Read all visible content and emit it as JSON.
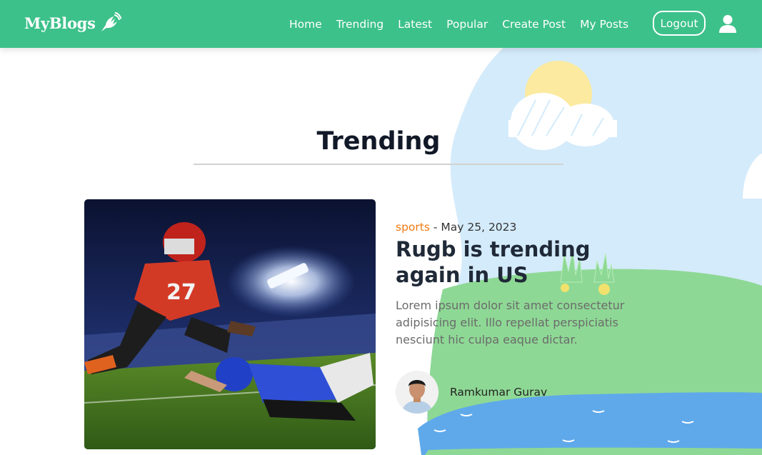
{
  "navbar": {
    "brand": "MyBlogs",
    "brand_icon": "quill-pen-icon",
    "links": [
      "Home",
      "Trending",
      "Latest",
      "Popular",
      "Create Post",
      "My Posts"
    ],
    "logout_label": "Logout",
    "user_icon": "user-icon"
  },
  "section": {
    "title": "Trending"
  },
  "post": {
    "category": "sports",
    "separator": " - ",
    "date": "May 25, 2023",
    "title": "Rugb is trending again in US",
    "excerpt": "Lorem ipsum dolor sit amet consectetur adipisicing elit. Illo repellat perspiciatis nesciunt hic culpa eaque dictar.",
    "author": "Ramkumar Gurav"
  },
  "colors": {
    "navbar": "#3cc18a",
    "category": "#f07a12",
    "title": "#1f2937",
    "excerpt": "#6b6b6b"
  }
}
